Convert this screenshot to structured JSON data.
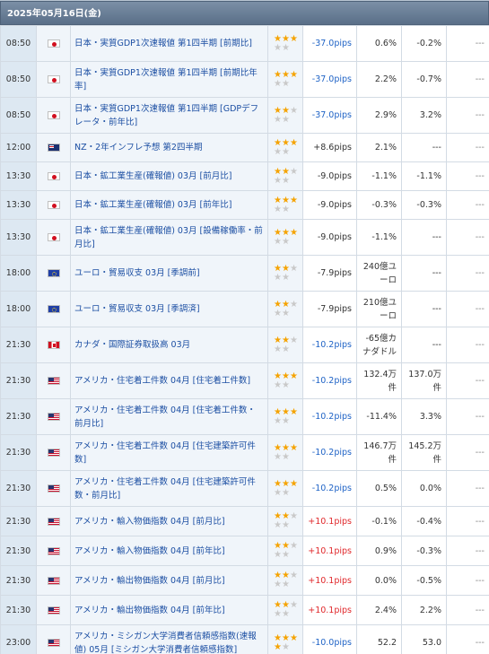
{
  "header": {
    "date": "2025年05月16日(金)"
  },
  "rows": [
    {
      "time": "08:50",
      "flag": "jp",
      "name": "日本・実質GDP1次速報値 第1四半期 [前期比]",
      "stars": 3,
      "pips": "-37.0pips",
      "dir": "neg",
      "actual": "0.6%",
      "forecast": "-0.2%",
      "prev": "---"
    },
    {
      "time": "08:50",
      "flag": "jp",
      "name": "日本・実質GDP1次速報値 第1四半期 [前期比年率]",
      "stars": 3,
      "pips": "-37.0pips",
      "dir": "neg",
      "actual": "2.2%",
      "forecast": "-0.7%",
      "prev": "---"
    },
    {
      "time": "08:50",
      "flag": "jp",
      "name": "日本・実質GDP1次速報値 第1四半期 [GDPデフレータ・前年比]",
      "stars": 2,
      "pips": "-37.0pips",
      "dir": "neg",
      "actual": "2.9%",
      "forecast": "3.2%",
      "prev": "---"
    },
    {
      "time": "12:00",
      "flag": "nz",
      "name": "NZ・2年インフレ予想 第2四半期",
      "stars": 3,
      "pips": "+8.6pips",
      "dir": "plain",
      "actual": "2.1%",
      "forecast": "---",
      "prev": "---"
    },
    {
      "time": "13:30",
      "flag": "jp",
      "name": "日本・鉱工業生産(確報値) 03月 [前月比]",
      "stars": 2,
      "pips": "-9.0pips",
      "dir": "plain",
      "actual": "-1.1%",
      "forecast": "-1.1%",
      "prev": "---"
    },
    {
      "time": "13:30",
      "flag": "jp",
      "name": "日本・鉱工業生産(確報値) 03月 [前年比]",
      "stars": 3,
      "pips": "-9.0pips",
      "dir": "plain",
      "actual": "-0.3%",
      "forecast": "-0.3%",
      "prev": "---"
    },
    {
      "time": "13:30",
      "flag": "jp",
      "name": "日本・鉱工業生産(確報値) 03月 [設備稼働率・前月比]",
      "stars": 3,
      "pips": "-9.0pips",
      "dir": "plain",
      "actual": "-1.1%",
      "forecast": "---",
      "prev": "---"
    },
    {
      "time": "18:00",
      "flag": "eu",
      "name": "ユーロ・貿易収支 03月 [季調前]",
      "stars": 2,
      "pips": "-7.9pips",
      "dir": "plain",
      "actual": "240億ユーロ",
      "forecast": "---",
      "prev": "---"
    },
    {
      "time": "18:00",
      "flag": "eu",
      "name": "ユーロ・貿易収支 03月 [季調済]",
      "stars": 2,
      "pips": "-7.9pips",
      "dir": "plain",
      "actual": "210億ユーロ",
      "forecast": "---",
      "prev": "---"
    },
    {
      "time": "21:30",
      "flag": "ca",
      "name": "カナダ・国際証券取扱高 03月",
      "stars": 2,
      "pips": "-10.2pips",
      "dir": "neg",
      "actual": "-65億カナダドル",
      "forecast": "---",
      "prev": "---"
    },
    {
      "time": "21:30",
      "flag": "us",
      "name": "アメリカ・住宅着工件数 04月 [住宅着工件数]",
      "stars": 3,
      "pips": "-10.2pips",
      "dir": "neg",
      "actual": "132.4万件",
      "forecast": "137.0万件",
      "prev": "---"
    },
    {
      "time": "21:30",
      "flag": "us",
      "name": "アメリカ・住宅着工件数 04月 [住宅着工件数・前月比]",
      "stars": 3,
      "pips": "-10.2pips",
      "dir": "neg",
      "actual": "-11.4%",
      "forecast": "3.3%",
      "prev": "---"
    },
    {
      "time": "21:30",
      "flag": "us",
      "name": "アメリカ・住宅着工件数 04月 [住宅建築許可件数]",
      "stars": 3,
      "pips": "-10.2pips",
      "dir": "neg",
      "actual": "146.7万件",
      "forecast": "145.2万件",
      "prev": "---"
    },
    {
      "time": "21:30",
      "flag": "us",
      "name": "アメリカ・住宅着工件数 04月 [住宅建築許可件数・前月比]",
      "stars": 3,
      "pips": "-10.2pips",
      "dir": "neg",
      "actual": "0.5%",
      "forecast": "0.0%",
      "prev": "---"
    },
    {
      "time": "21:30",
      "flag": "us",
      "name": "アメリカ・輸入物価指数 04月 [前月比]",
      "stars": 2,
      "pips": "+10.1pips",
      "dir": "pos",
      "actual": "-0.1%",
      "forecast": "-0.4%",
      "prev": "---"
    },
    {
      "time": "21:30",
      "flag": "us",
      "name": "アメリカ・輸入物価指数 04月 [前年比]",
      "stars": 2,
      "pips": "+10.1pips",
      "dir": "pos",
      "actual": "0.9%",
      "forecast": "-0.3%",
      "prev": "---"
    },
    {
      "time": "21:30",
      "flag": "us",
      "name": "アメリカ・輸出物価指数 04月 [前月比]",
      "stars": 2,
      "pips": "+10.1pips",
      "dir": "pos",
      "actual": "0.0%",
      "forecast": "-0.5%",
      "prev": "---"
    },
    {
      "time": "21:30",
      "flag": "us",
      "name": "アメリカ・輸出物価指数 04月 [前年比]",
      "stars": 2,
      "pips": "+10.1pips",
      "dir": "pos",
      "actual": "2.4%",
      "forecast": "2.2%",
      "prev": "---"
    },
    {
      "time": "23:00",
      "flag": "us",
      "name": "アメリカ・ミシガン大学消費者信頼感指数(速報値) 05月 [ミシガン大学消費者信頼感指数]",
      "stars": 4,
      "pips": "-10.0pips",
      "dir": "neg",
      "actual": "52.2",
      "forecast": "53.0",
      "prev": "---"
    }
  ]
}
